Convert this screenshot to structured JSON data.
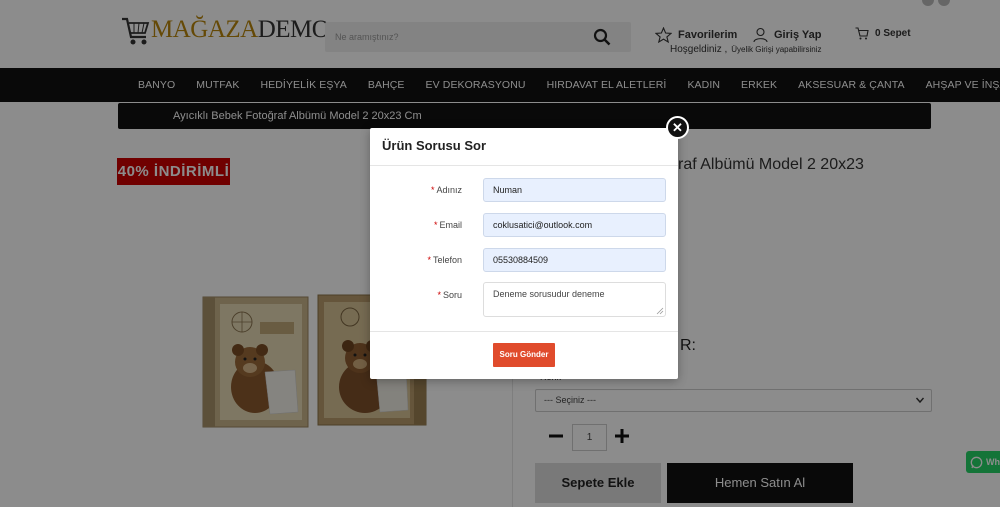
{
  "header": {
    "logo_part1": "MAĞAZA",
    "logo_part2": "DEMO",
    "search_placeholder": "Ne aramıştınız?",
    "favorites_label": "Favorilerim",
    "login_label": "Giriş Yap",
    "welcome_text": "Hoşgeldiniz ,",
    "welcome_sub": "Üyelik Girişi yapabilirsiniz",
    "cart_label": "0 Sepet"
  },
  "nav": {
    "items": [
      "BANYO",
      "MUTFAK",
      "HEDİYELİK EŞYA",
      "BAHÇE",
      "EV DEKORASYONU",
      "HIRDAVAT EL ALETLERİ",
      "KADIN",
      "ERKEK",
      "AKSESUAR & ÇANTA",
      "AHŞAP VE İNŞAAT"
    ]
  },
  "breadcrumb": "Ayıcıklı Bebek Fotoğraf Albümü Model 2 20x23 Cm",
  "product": {
    "badge": "40% İNDİRİMLİ",
    "title_visible": "raf Albümü Model 2 20x23",
    "section_label": "R:",
    "select_label": "Renk",
    "select_value": "--- Seçiniz ---",
    "quantity": "1",
    "add_to_cart": "Sepete Ekle",
    "buy_now": "Hemen Satın Al"
  },
  "whatsapp_label": "Wh",
  "modal": {
    "title": "Ürün Sorusu Sor",
    "close_symbol": "✕",
    "fields": {
      "name_label": "Adınız",
      "name_value": "Numan",
      "email_label": "Email",
      "email_value": "coklusatici@outlook.com",
      "phone_label": "Telefon",
      "phone_value": "05530884509",
      "question_label": "Soru",
      "question_value": "Deneme sorusudur deneme"
    },
    "required_mark": "*",
    "submit_label": "Soru Gönder"
  },
  "colors": {
    "accent_red": "#e04b2c",
    "badge_red": "#cc0000",
    "nav_bg": "#111111",
    "input_autofill": "#e8f0fe"
  }
}
